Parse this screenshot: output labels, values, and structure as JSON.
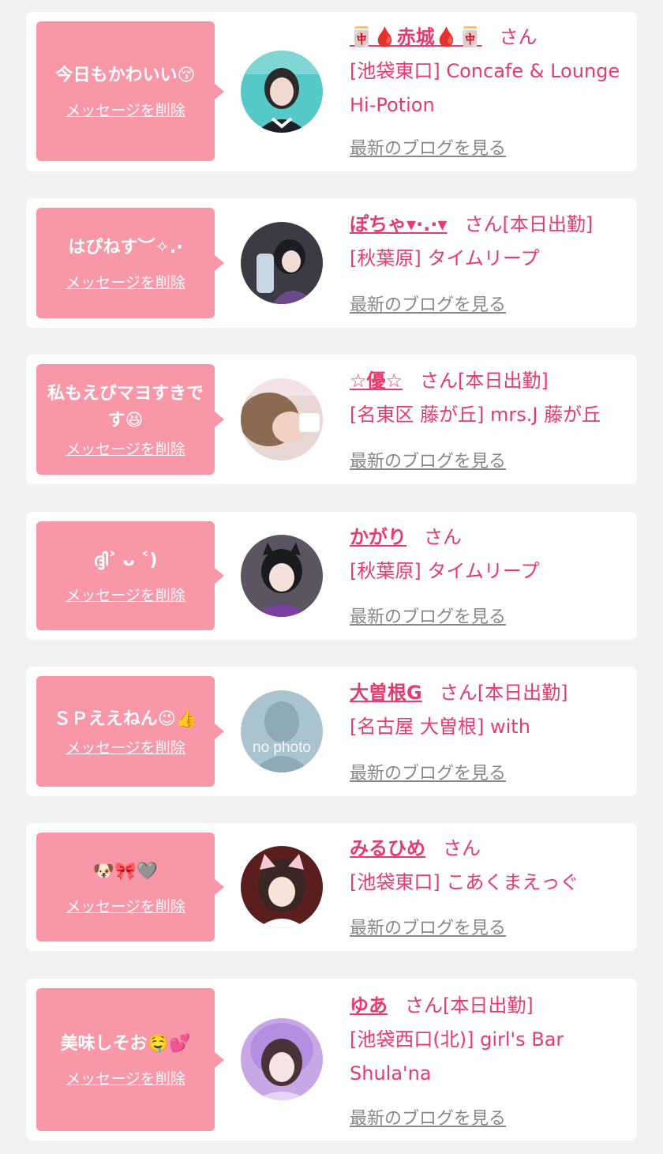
{
  "san_label": "さん",
  "delete_label": "メッセージを削除",
  "blog_label": "最新のブログを見る",
  "colors": {
    "bubble": "#f797a7",
    "accent": "#e83a6e",
    "link_gray": "#888888",
    "background": "#f2f2f2"
  },
  "entries": [
    {
      "message": "今日もかわいい😚",
      "name": "🀄🩸赤城🩸🀄",
      "work_status": "",
      "shop": "[池袋東口] Concafe & Lounge Hi-Potion"
    },
    {
      "message": "はぴねす︶✧.·",
      "name": "ぽちゃ▾·.·▾",
      "work_status": "[本日出勤]",
      "shop": "[秋葉原] タイムリープ"
    },
    {
      "message": "私もえびマヨすきです😆",
      "name": "☆優☆",
      "work_status": "[本日出勤]",
      "shop": "[名東区 藤が丘] mrs.J 藤が丘"
    },
    {
      "message": "ദ്ദി˃ ᴗ ˂)",
      "name": "かがり",
      "work_status": "",
      "shop": "[秋葉原] タイムリープ"
    },
    {
      "message": "ＳＰええねん😉👍",
      "name": "大曽根G",
      "work_status": "[本日出勤]",
      "shop": "[名古屋 大曽根] with",
      "avatar_text": "no photo"
    },
    {
      "message": "🐶🎀🩶",
      "name": "みるひめ",
      "work_status": "",
      "shop": "[池袋東口] こあくまえっぐ"
    },
    {
      "message": "美味しそお🤤💕",
      "name": "ゆあ",
      "work_status": "[本日出勤]",
      "shop": "[池袋西口(北)] girl's Bar Shula'na"
    }
  ]
}
